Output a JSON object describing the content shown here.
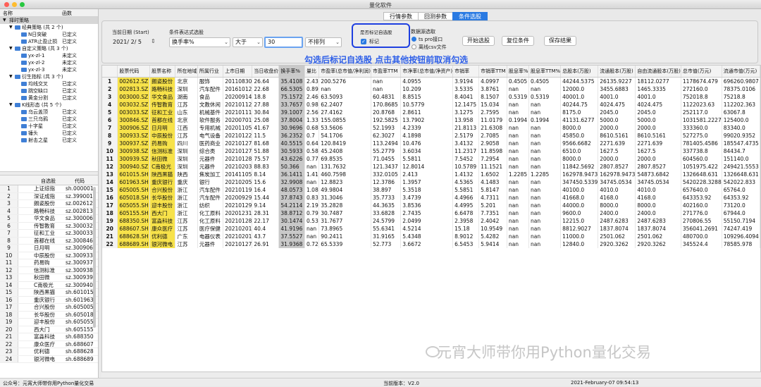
{
  "window": {
    "title": "量化软件"
  },
  "colors": {
    "accent": "#2a7ae2",
    "highlight_yellow": "#f7e24a",
    "annotation_blue": "#2e5fe8",
    "folder_blue": "#3f7fd6"
  },
  "left_panel": {
    "headers": [
      "名称",
      "函数"
    ],
    "tree": [
      {
        "label": "择时策略",
        "level": 0,
        "status": "",
        "folder": false,
        "expand": "▼"
      },
      {
        "label": "经典策略 (共 2 个)",
        "level": 1,
        "status": "",
        "folder": true,
        "expand": "▼"
      },
      {
        "label": "N日突破",
        "level": 2,
        "status": "已定义",
        "folder": true,
        "expand": ""
      },
      {
        "label": "ATR止盈止损",
        "level": 2,
        "status": "已定义",
        "folder": true,
        "expand": ""
      },
      {
        "label": "自定义策略 (共 3 个)",
        "level": 1,
        "status": "",
        "folder": true,
        "expand": "▼"
      },
      {
        "label": "yx-zl-1",
        "level": 2,
        "status": "未定义",
        "folder": true,
        "expand": ""
      },
      {
        "label": "yx-zl-2",
        "level": 2,
        "status": "未定义",
        "folder": true,
        "expand": ""
      },
      {
        "label": "yx-zl-3",
        "level": 2,
        "status": "未定义",
        "folder": true,
        "expand": ""
      },
      {
        "label": "衍生指标 (共 3 个)",
        "level": 1,
        "status": "",
        "folder": true,
        "expand": "▼"
      },
      {
        "label": "均线交叉",
        "level": 2,
        "status": "已定义",
        "folder": true,
        "expand": ""
      },
      {
        "label": "跳空缺口",
        "level": 2,
        "status": "已定义",
        "folder": true,
        "expand": ""
      },
      {
        "label": "黄金分割",
        "level": 2,
        "status": "已定义",
        "folder": true,
        "expand": ""
      },
      {
        "label": "K线形态 (共 5 个)",
        "level": 1,
        "status": "",
        "folder": true,
        "expand": "▼"
      },
      {
        "label": "乌云盖顶",
        "level": 2,
        "status": "已定义",
        "folder": true,
        "expand": ""
      },
      {
        "label": "三只乌鸦",
        "level": 2,
        "status": "已定义",
        "folder": true,
        "expand": ""
      },
      {
        "label": "十字星",
        "level": 2,
        "status": "已定义",
        "folder": true,
        "expand": ""
      },
      {
        "label": "锤头",
        "level": 2,
        "status": "已定义",
        "folder": true,
        "expand": ""
      },
      {
        "label": "射击之星",
        "level": 2,
        "status": "已定义",
        "folder": true,
        "expand": ""
      }
    ],
    "watchlist_headers": [
      "自选股",
      "代码"
    ],
    "watchlist": [
      [
        "上证综指",
        "sh.000001"
      ],
      [
        "深证成指",
        "sz.399001"
      ],
      [
        "朗姿股份",
        "sz.002612"
      ],
      [
        "路畅科技",
        "sz.002813"
      ],
      [
        "华文食品",
        "sz.300006"
      ],
      [
        "传智教育",
        "sz.300032"
      ],
      [
        "征和工业",
        "sz.300033"
      ],
      [
        "首都在线",
        "sz.300846"
      ],
      [
        "日月明",
        "sz.300906"
      ],
      [
        "中辰股份",
        "sz.300933"
      ],
      [
        "药易购",
        "sz.300937"
      ],
      [
        "信测标准",
        "sz.300938"
      ],
      [
        "秋田微",
        "sz.300939"
      ],
      [
        "C南极光",
        "sz.300940"
      ],
      [
        "陕西黑猫",
        "sh.601015"
      ],
      [
        "重庆银行",
        "sh.601963"
      ],
      [
        "合兴股份",
        "sh.605005"
      ],
      [
        "长华股份",
        "sh.605018"
      ],
      [
        "迎丰股份",
        "sh.605055"
      ],
      [
        "西大门",
        "sh.605155"
      ],
      [
        "富淼科技",
        "sh.688350"
      ],
      [
        "康众医疗",
        "sh.688607"
      ],
      [
        "优利德",
        "sh.688628"
      ],
      [
        "银河微电",
        "sh.688689"
      ]
    ]
  },
  "tabs": [
    {
      "label": "行情参数",
      "active": false
    },
    {
      "label": "回测参数",
      "active": false
    },
    {
      "label": "条件选股",
      "active": true
    }
  ],
  "form": {
    "date_label": "当前日期 (Start)",
    "date_value": "2021/  2/  5",
    "expr_label": "条件表达式选股",
    "field_value": "换手率%",
    "op_value": "大于",
    "threshold_value": "30",
    "sort_value": "不排列",
    "mark_label": "是否标记自选股",
    "mark_checkbox_label": "标记",
    "source_label": "数据源选取",
    "source_opt1": "ts pro接口",
    "source_opt2": "离线csv文件",
    "btn_start": "开始选股",
    "btn_reset": "复位条件",
    "btn_save": "保存结果",
    "annotation": "勾选后标记自选股 点击其他按钮前取消勾选"
  },
  "table": {
    "headers": [
      "",
      "股票代码",
      "股票名称",
      "所在地域",
      "所属行业",
      "上市日期",
      "当日收盘价",
      "换手率%",
      "量比",
      "市盈率(总市值/净利润)",
      "市盈率TTM",
      "市净率(总市值/净资产)",
      "市销率",
      "市销率TTM",
      "股息率%",
      "股息率TTM%",
      "总股本(万股)",
      "流通股本(万股)",
      "自由流通股本(万股)",
      "总市值(万元)",
      "流通市值(万元)"
    ],
    "rows": [
      [
        "1",
        "002612.SZ",
        "朗姿股份",
        "北京",
        "服饰",
        "20110830",
        "26.64",
        "35.4108",
        "2.43",
        "200.5276",
        "nan",
        "4.0955",
        "3.9194",
        "4.0997",
        "0.4505",
        "0.4505",
        "44244.5375",
        "26135.9227",
        "18112.0277",
        "1178674.479",
        "696260.9807"
      ],
      [
        "2",
        "002813.SZ",
        "路畅科技",
        "深圳",
        "汽车配件",
        "20161012",
        "22.68",
        "66.5305",
        "0.89",
        "nan",
        "nan",
        "10.209",
        "3.5335",
        "3.8761",
        "nan",
        "nan",
        "12000.0",
        "3455.6883",
        "1465.3335",
        "272160.0",
        "78375.0106"
      ],
      [
        "3",
        "003000.SZ",
        "华文食品",
        "湖南",
        "食品",
        "20200914",
        "18.8",
        "75.1572",
        "2.46",
        "63.5093",
        "60.4831",
        "8.8515",
        "8.4041",
        "8.1507",
        "0.5319",
        "0.5319",
        "40001.0",
        "4001.0",
        "4001.0",
        "752018.8",
        "75218.8"
      ],
      [
        "4",
        "003032.SZ",
        "传智教育",
        "江苏",
        "文教休闲",
        "20210112",
        "27.88",
        "33.7657",
        "0.98",
        "62.2407",
        "170.8685",
        "10.5779",
        "12.1475",
        "15.034",
        "nan",
        "nan",
        "40244.75",
        "4024.475",
        "4024.475",
        "1122023.63",
        "112202.363"
      ],
      [
        "5",
        "003033.SZ",
        "征和工业",
        "山东",
        "机械基件",
        "20210111",
        "30.84",
        "39.1007",
        "2.56",
        "27.4162",
        "20.8768",
        "2.8611",
        "3.1275",
        "2.7595",
        "nan",
        "nan",
        "8175.0",
        "2045.0",
        "2045.0",
        "252117.0",
        "63067.8"
      ],
      [
        "6",
        "300846.SZ",
        "首都在线",
        "北京",
        "软件服务",
        "20200701",
        "25.08",
        "37.8004",
        "1.33",
        "155.0855",
        "192.5825",
        "13.7902",
        "13.958",
        "11.0179",
        "0.1994",
        "0.1994",
        "41131.6277",
        "5000.0",
        "5000.0",
        "1031581.2227",
        "125400.0"
      ],
      [
        "7",
        "300906.SZ",
        "日月明",
        "江西",
        "专用机械",
        "20201105",
        "41.67",
        "30.9696",
        "0.68",
        "53.5606",
        "52.1993",
        "4.2339",
        "21.8113",
        "21.6308",
        "nan",
        "nan",
        "8000.0",
        "2000.0",
        "2000.0",
        "333360.0",
        "83340.0"
      ],
      [
        "8",
        "300933.SZ",
        "中辰股份",
        "江苏",
        "电气设备",
        "20210122",
        "11.5",
        "36.2352",
        "0.7",
        "54.1706",
        "62.3027",
        "4.1898",
        "2.5179",
        "2.7085",
        "nan",
        "nan",
        "45850.0",
        "8610.5161",
        "8610.5161",
        "527275.0",
        "99020.9352"
      ],
      [
        "9",
        "300937.SZ",
        "药易购",
        "四川",
        "医药商业",
        "20210127",
        "81.68",
        "40.5515",
        "0.64",
        "120.8419",
        "113.2494",
        "10.476",
        "3.4132",
        "2.9058",
        "nan",
        "nan",
        "9566.6682",
        "2271.639",
        "2271.639",
        "781405.4586",
        "185547.4735"
      ],
      [
        "10",
        "300938.SZ",
        "信测标准",
        "深圳",
        "综合类",
        "20210127",
        "51.88",
        "30.5933",
        "0.58",
        "45.2408",
        "55.2779",
        "3.6034",
        "11.2317",
        "11.8598",
        "nan",
        "nan",
        "6510.0",
        "1627.5",
        "1627.5",
        "337738.8",
        "84434.7"
      ],
      [
        "11",
        "300939.SZ",
        "秋田微",
        "深圳",
        "元器件",
        "20210128",
        "75.57",
        "43.6226",
        "0.77",
        "69.8535",
        "71.0455",
        "5.5811",
        "7.5452",
        "7.2954",
        "nan",
        "nan",
        "8000.0",
        "2000.0",
        "2000.0",
        "604560.0",
        "151140.0"
      ],
      [
        "12",
        "300940.SZ",
        "C南极光",
        "深圳",
        "元器件",
        "20210203",
        "88.83",
        "50.366",
        "nan",
        "131.7632",
        "121.3437",
        "12.8014",
        "10.5789",
        "11.1521",
        "nan",
        "nan",
        "11842.5692",
        "2807.8527",
        "2807.8527",
        "1051975.422",
        "249421.5553"
      ],
      [
        "13",
        "601015.SH",
        "陕西黑猫",
        "陕西",
        "焦炭加工",
        "20141105",
        "8.14",
        "36.1411",
        "1.41",
        "460.7598",
        "332.0105",
        "2.413",
        "1.4132",
        "1.6502",
        "1.2285",
        "1.2285",
        "162978.9473",
        "162978.9473",
        "54873.6842",
        "1326648.631",
        "1326648.631"
      ],
      [
        "14",
        "601963.SH",
        "重庆银行",
        "重庆",
        "银行",
        "20210205",
        "15.6",
        "32.9908",
        "nan",
        "12.8823",
        "12.3786",
        "1.3957",
        "4.5365",
        "4.1483",
        "nan",
        "nan",
        "347450.5339",
        "34745.0534",
        "34745.0534",
        "5420228.3288",
        "542022.833"
      ],
      [
        "15",
        "605005.SH",
        "合兴股份",
        "浙江",
        "汽车配件",
        "20210119",
        "16.4",
        "48.0573",
        "1.08",
        "49.9804",
        "38.897",
        "5.3518",
        "5.5851",
        "5.8147",
        "nan",
        "nan",
        "40100.0",
        "4010.0",
        "4010.0",
        "657640.0",
        "65764.0"
      ],
      [
        "16",
        "605018.SH",
        "长华股份",
        "浙江",
        "汽车配件",
        "20200929",
        "15.44",
        "37.8743",
        "0.83",
        "31.3046",
        "35.7733",
        "3.4739",
        "4.4966",
        "4.7311",
        "nan",
        "nan",
        "41668.0",
        "4168.0",
        "4168.0",
        "643353.92",
        "64353.92"
      ],
      [
        "17",
        "605055.SH",
        "迎丰股份",
        "浙江",
        "纺织",
        "20210129",
        "9.14",
        "54.2114",
        "2.19",
        "35.2828",
        "44.3635",
        "3.8536",
        "4.4995",
        "5.201",
        "nan",
        "nan",
        "44000.0",
        "8000.0",
        "8000.0",
        "402160.0",
        "73120.0"
      ],
      [
        "18",
        "605155.SH",
        "西大门",
        "浙江",
        "化工原料",
        "20201231",
        "28.31",
        "38.8712",
        "0.79",
        "30.7487",
        "33.6828",
        "2.7435",
        "6.6478",
        "7.7351",
        "nan",
        "nan",
        "9600.0",
        "2400.0",
        "2400.0",
        "271776.0",
        "67944.0"
      ],
      [
        "19",
        "688350.SH",
        "富淼科技",
        "江苏",
        "化工原料",
        "20210128",
        "22.17",
        "30.1474",
        "0.53",
        "31.7677",
        "24.5799",
        "2.0499",
        "2.3958",
        "2.4042",
        "nan",
        "nan",
        "12215.0",
        "2487.6283",
        "2487.6283",
        "270806.55",
        "55150.7194"
      ],
      [
        "20",
        "688607.SH",
        "康众医疗",
        "江苏",
        "医疗保健",
        "20210201",
        "40.4",
        "41.9196",
        "nan",
        "73.8965",
        "55.6341",
        "4.5214",
        "15.18",
        "10.9549",
        "nan",
        "nan",
        "8812.9027",
        "1837.8074",
        "1837.8074",
        "356041.2691",
        "74247.419"
      ],
      [
        "21",
        "688628.SH",
        "优利德",
        "广东",
        "电器仪表",
        "20210201",
        "43.7",
        "37.5527",
        "nan",
        "90.2411",
        "31.9165",
        "5.4348",
        "8.9012",
        "5.4282",
        "nan",
        "nan",
        "11000.0",
        "2501.062",
        "2501.062",
        "480700.0",
        "109296.4094"
      ],
      [
        "22",
        "688689.SH",
        "银河微电",
        "江苏",
        "元器件",
        "20210127",
        "26.91",
        "31.9368",
        "0.72",
        "65.5339",
        "52.773",
        "3.6672",
        "6.5453",
        "5.9414",
        "nan",
        "nan",
        "12840.0",
        "2920.3262",
        "2920.3262",
        "345524.4",
        "78585.978"
      ]
    ]
  },
  "status": {
    "left": "公众号：元宵大师带你用Python量化交易",
    "version": "当前版本：V2.0",
    "datetime": "2021-February-07 09:54:13"
  },
  "watermark": "元宵大师带你用Python量化交易"
}
